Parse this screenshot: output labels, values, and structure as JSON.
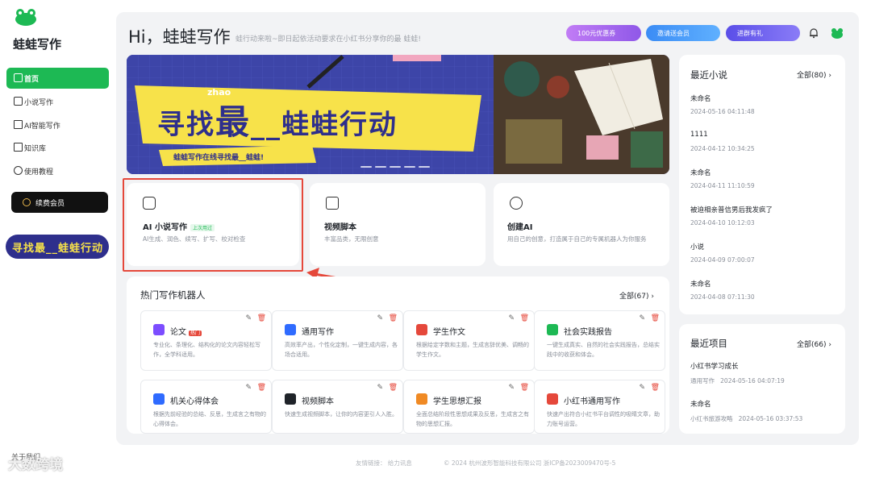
{
  "app": {
    "name": "蛙蛙写作"
  },
  "sidebar": {
    "items": [
      {
        "label": "首页",
        "icon": "home-icon",
        "active": true
      },
      {
        "label": "小说写作",
        "icon": "novel-icon"
      },
      {
        "label": "AI智能写作",
        "icon": "ai-icon"
      },
      {
        "label": "知识库",
        "icon": "book-icon"
      },
      {
        "label": "使用教程",
        "icon": "info-icon"
      }
    ],
    "vip_label": "续费会员",
    "promo_text": "寻找最__蛙蛙行动",
    "contact": "关于我们"
  },
  "header": {
    "greeting": "Hi，蛙蛙写作",
    "marquee": "蛙行动来啦~即日起依活动要求在小红书分享你的最  蛙蛙!",
    "buttons": [
      {
        "label": "100元优惠券",
        "color": "#b06cf0"
      },
      {
        "label": "邀请送会员",
        "color": "#3b8cf5"
      },
      {
        "label": "进群有礼",
        "color": "#6a5cf0"
      }
    ]
  },
  "banner": {
    "headline_1": "寻找",
    "headline_pinyin": "zhao",
    "headline_2": "最",
    "headline_3": "__蛙蛙行动",
    "sub": "蛙蛙写作在线寻找最__蛙蛙!"
  },
  "feature_cards": [
    {
      "title": "AI 小说写作",
      "tag": "上次用过",
      "desc": "AI生成、润色、续写、扩写、校对检查"
    },
    {
      "title": "视频脚本",
      "tag": "",
      "desc": "丰富品类，无限创意"
    },
    {
      "title": "创建AI",
      "tag": "",
      "desc": "用自己的创意，打造属于自己的专属机器人为你服务"
    }
  ],
  "hot_robots": {
    "title": "热门写作机器人",
    "all_label": "全部(67)",
    "items": [
      {
        "name": "论文",
        "badge": "热门",
        "desc": "专业化、条理化、结构化的论文内容轻松写作，全学科适用。",
        "color": "#7c4dff"
      },
      {
        "name": "通用写作",
        "badge": "",
        "desc": "高效率产出，个性化定制，一键生成内容，各场合适用。",
        "color": "#2f6bff"
      },
      {
        "name": "学生作文",
        "badge": "",
        "desc": "根据给定字数和主题，生成言辞优美、调畅的学生作文。",
        "color": "#e5483b"
      },
      {
        "name": "社会实践报告",
        "badge": "",
        "desc": "一键生成真实、自然的社会实践报告，总结实践中的收获和体会。",
        "color": "#1db954"
      },
      {
        "name": "机关心得体会",
        "badge": "",
        "desc": "根据先前经验的总结、反思，生成言之有物的心得体会。",
        "color": "#2f6bff"
      },
      {
        "name": "视频脚本",
        "badge": "",
        "desc": "快速生成视频脚本，让你的内容更引人入胜。",
        "color": "#1f2329"
      },
      {
        "name": "学生思想汇报",
        "badge": "",
        "desc": "全面总结阶段性思想成果及反思，生成言之有物的思想汇报。",
        "color": "#f08a24"
      },
      {
        "name": "小红书通用写作",
        "badge": "",
        "desc": "快速产出符合小红书平台调性的吸睛文章，助力账号运营。",
        "color": "#e5483b"
      }
    ]
  },
  "recent_novels": {
    "title": "最近小说",
    "all_label": "全部(80)",
    "items": [
      {
        "name": "未命名",
        "time": "2024-05-16 04:11:48"
      },
      {
        "name": "1111",
        "time": "2024-04-12 10:34:25"
      },
      {
        "name": "未命名",
        "time": "2024-04-11 11:10:59"
      },
      {
        "name": "被迫相亲普信男后我发疯了",
        "time": "2024-04-10 10:12:03"
      },
      {
        "name": "小说",
        "time": "2024-04-09 07:00:07"
      },
      {
        "name": "未命名",
        "time": "2024-04-08 07:11:30"
      }
    ]
  },
  "recent_projects": {
    "title": "最近项目",
    "all_label": "全部(66)",
    "items": [
      {
        "name": "小红书学习成长",
        "type": "通用写作",
        "time": "2024-05-16 04:07:19"
      },
      {
        "name": "未命名",
        "type": "小红书旅游攻略",
        "time": "2024-05-16 03:37:53"
      }
    ]
  },
  "footer": {
    "links_label": "友情链接：",
    "link": "给力讯息",
    "copyright": "© 2024 杭州波形智能科技有限公司 浙ICP备2023009470号-5"
  },
  "watermark": "大数跨境"
}
